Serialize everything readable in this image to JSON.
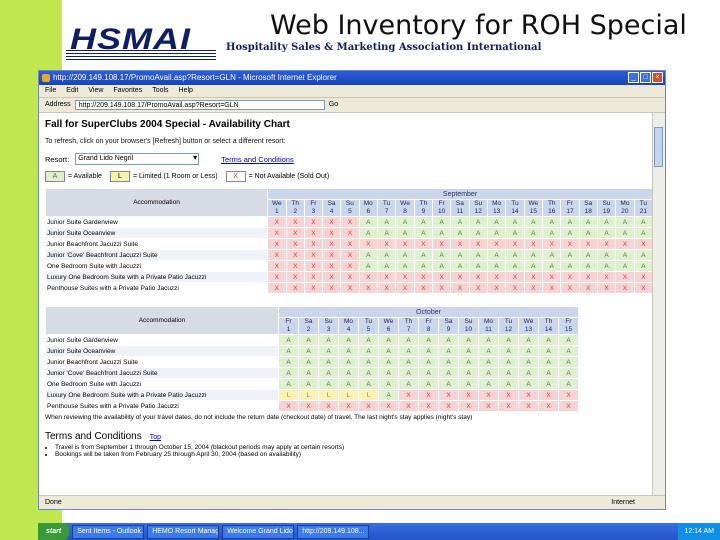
{
  "slide": {
    "title": "Web Inventory for ROH Special",
    "logo": "HSMAI",
    "tagline": "Hospitality Sales & Marketing Association International"
  },
  "browser": {
    "window_title": "http://209.149.108.17/PromoAvail.asp?Resort=GLN - Microsoft Internet Explorer",
    "menu": [
      "File",
      "Edit",
      "View",
      "Favorites",
      "Tools",
      "Help"
    ],
    "address_label": "Address",
    "address": "http://209.149.108.17/PromoAvail.asp?Resort=GLN",
    "go_label": "Go",
    "status_left": "Done",
    "status_zone": "Internet"
  },
  "page": {
    "heading": "Fall for SuperClubs 2004 Special - Availability Chart",
    "instructions": "To refresh, click on your browser's [Refresh] button or select a different resort:",
    "resort_label": "Resort:",
    "resort_value": "Grand Lido Negril",
    "terms_link": "Terms and Conditions",
    "legend": {
      "available_sym": "A",
      "available": "= Available",
      "limited_sym": "L",
      "limited": "= Limited (1 Room or Less)",
      "soldout_sym": "X",
      "soldout": "= Not Available (Sold Out)"
    },
    "acc_header": "Accommodation",
    "footnote": "When reviewing the availability of your travel dates, do not include the return date (checkout date) of travel. The last night's stay applies (night's stay)",
    "terms_heading": "Terms and Conditions",
    "terms_top": "Top",
    "terms": [
      "Travel is from September 1 through October 15, 2004 (blackout periods may apply at certain resorts)",
      "Bookings will be taken from February 25 through April 30, 2004 (based on availability)"
    ]
  },
  "september": {
    "month": "September",
    "days": [
      [
        "We",
        "1"
      ],
      [
        "Th",
        "2"
      ],
      [
        "Fr",
        "3"
      ],
      [
        "Sa",
        "4"
      ],
      [
        "Su",
        "5"
      ],
      [
        "Mo",
        "6"
      ],
      [
        "Tu",
        "7"
      ],
      [
        "We",
        "8"
      ],
      [
        "Th",
        "9"
      ],
      [
        "Fr",
        "10"
      ],
      [
        "Sa",
        "11"
      ],
      [
        "Su",
        "12"
      ],
      [
        "Mo",
        "13"
      ],
      [
        "Tu",
        "14"
      ],
      [
        "We",
        "15"
      ],
      [
        "Th",
        "16"
      ],
      [
        "Fr",
        "17"
      ],
      [
        "Sa",
        "18"
      ],
      [
        "Su",
        "19"
      ],
      [
        "Mo",
        "20"
      ],
      [
        "Tu",
        "21"
      ]
    ],
    "rows": [
      {
        "name": "Junior Suite Gardenview",
        "cells": [
          "X",
          "X",
          "X",
          "X",
          "X",
          "A",
          "A",
          "A",
          "A",
          "A",
          "A",
          "A",
          "A",
          "A",
          "A",
          "A",
          "A",
          "A",
          "A",
          "A",
          "A"
        ]
      },
      {
        "name": "Junior Suite Oceanview",
        "cells": [
          "X",
          "X",
          "X",
          "X",
          "X",
          "A",
          "A",
          "A",
          "A",
          "A",
          "A",
          "A",
          "A",
          "A",
          "A",
          "A",
          "A",
          "A",
          "A",
          "A",
          "A"
        ]
      },
      {
        "name": "Junior Beachfront Jacuzzi Suite",
        "cells": [
          "X",
          "X",
          "X",
          "X",
          "X",
          "X",
          "X",
          "X",
          "X",
          "X",
          "X",
          "X",
          "X",
          "X",
          "X",
          "X",
          "X",
          "X",
          "X",
          "X",
          "X"
        ]
      },
      {
        "name": "Junior 'Cove' Beachfront Jacuzzi Suite",
        "cells": [
          "X",
          "X",
          "X",
          "X",
          "X",
          "A",
          "A",
          "A",
          "A",
          "A",
          "A",
          "A",
          "A",
          "A",
          "A",
          "A",
          "A",
          "A",
          "A",
          "A",
          "A"
        ]
      },
      {
        "name": "One Bedroom Suite with Jacuzzi",
        "cells": [
          "X",
          "X",
          "X",
          "X",
          "X",
          "A",
          "A",
          "A",
          "A",
          "A",
          "A",
          "A",
          "A",
          "A",
          "A",
          "A",
          "A",
          "A",
          "A",
          "A",
          "A"
        ]
      },
      {
        "name": "Luxury One Bedroom Suite with a Private Patio Jacuzzi",
        "cells": [
          "X",
          "X",
          "X",
          "X",
          "X",
          "X",
          "X",
          "X",
          "X",
          "X",
          "X",
          "X",
          "X",
          "X",
          "X",
          "X",
          "X",
          "X",
          "X",
          "X",
          "X"
        ]
      },
      {
        "name": "Penthouse Suites with a Private Patio Jacuzzi",
        "cells": [
          "X",
          "X",
          "X",
          "X",
          "X",
          "X",
          "X",
          "X",
          "X",
          "X",
          "X",
          "X",
          "X",
          "X",
          "X",
          "X",
          "X",
          "X",
          "X",
          "X",
          "X"
        ]
      }
    ]
  },
  "october": {
    "month": "October",
    "days": [
      [
        "Fr",
        "1"
      ],
      [
        "Sa",
        "2"
      ],
      [
        "Su",
        "3"
      ],
      [
        "Mo",
        "4"
      ],
      [
        "Tu",
        "5"
      ],
      [
        "We",
        "6"
      ],
      [
        "Th",
        "7"
      ],
      [
        "Fr",
        "8"
      ],
      [
        "Sa",
        "9"
      ],
      [
        "Su",
        "10"
      ],
      [
        "Mo",
        "11"
      ],
      [
        "Tu",
        "12"
      ],
      [
        "We",
        "13"
      ],
      [
        "Th",
        "14"
      ],
      [
        "Fr",
        "15"
      ]
    ],
    "rows": [
      {
        "name": "Junior Suite Gardenview",
        "cells": [
          "A",
          "A",
          "A",
          "A",
          "A",
          "A",
          "A",
          "A",
          "A",
          "A",
          "A",
          "A",
          "A",
          "A",
          "A"
        ]
      },
      {
        "name": "Junior Suite Oceanview",
        "cells": [
          "A",
          "A",
          "A",
          "A",
          "A",
          "A",
          "A",
          "A",
          "A",
          "A",
          "A",
          "A",
          "A",
          "A",
          "A"
        ]
      },
      {
        "name": "Junior Beachfront Jacuzzi Suite",
        "cells": [
          "A",
          "A",
          "A",
          "A",
          "A",
          "A",
          "A",
          "A",
          "A",
          "A",
          "A",
          "A",
          "A",
          "A",
          "A"
        ]
      },
      {
        "name": "Junior 'Cove' Beachfront Jacuzzi Suite",
        "cells": [
          "A",
          "A",
          "A",
          "A",
          "A",
          "A",
          "A",
          "A",
          "A",
          "A",
          "A",
          "A",
          "A",
          "A",
          "A"
        ]
      },
      {
        "name": "One Bedroom Suite with Jacuzzi",
        "cells": [
          "A",
          "A",
          "A",
          "A",
          "A",
          "A",
          "A",
          "A",
          "A",
          "A",
          "A",
          "A",
          "A",
          "A",
          "A"
        ]
      },
      {
        "name": "Luxury One Bedroom Suite with a Private Patio Jacuzzi",
        "cells": [
          "L",
          "L",
          "L",
          "L",
          "L",
          "A",
          "X",
          "X",
          "X",
          "X",
          "X",
          "X",
          "X",
          "X",
          "X"
        ]
      },
      {
        "name": "Penthouse Suites with a Private Patio Jacuzzi",
        "cells": [
          "X",
          "X",
          "X",
          "X",
          "X",
          "X",
          "X",
          "X",
          "X",
          "X",
          "X",
          "X",
          "X",
          "X",
          "X"
        ]
      }
    ]
  },
  "taskbar": {
    "start": "start",
    "tasks": [
      "Sent Items - Outlook...",
      "HEMO Resort Manage...",
      "Welcome Grand Lido...",
      "http://209.149.108..."
    ],
    "time": "12:14 AM"
  }
}
